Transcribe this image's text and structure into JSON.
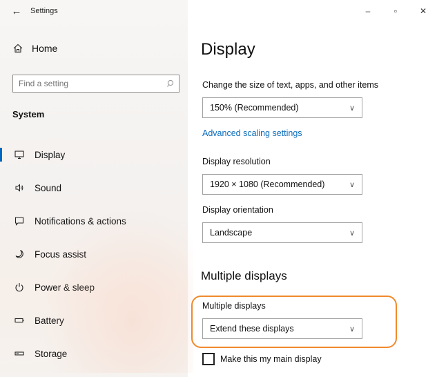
{
  "window": {
    "title": "Settings",
    "controls": {
      "minimize": "–",
      "maximize": "▫",
      "close": "✕"
    }
  },
  "sidebar": {
    "home_label": "Home",
    "search_placeholder": "Find a setting",
    "section": "System",
    "items": [
      {
        "label": "Display",
        "icon": "monitor-icon",
        "active": true
      },
      {
        "label": "Sound",
        "icon": "speaker-icon"
      },
      {
        "label": "Notifications & actions",
        "icon": "message-icon"
      },
      {
        "label": "Focus assist",
        "icon": "moon-icon"
      },
      {
        "label": "Power & sleep",
        "icon": "power-icon"
      },
      {
        "label": "Battery",
        "icon": "battery-icon"
      },
      {
        "label": "Storage",
        "icon": "storage-icon"
      }
    ]
  },
  "main": {
    "title": "Display",
    "scale": {
      "label": "Change the size of text, apps, and other items",
      "value": "150% (Recommended)"
    },
    "advanced_link": "Advanced scaling settings",
    "resolution": {
      "label": "Display resolution",
      "value": "1920 × 1080 (Recommended)"
    },
    "orientation": {
      "label": "Display orientation",
      "value": "Landscape"
    },
    "multiple_heading": "Multiple displays",
    "multiple": {
      "label": "Multiple displays",
      "value": "Extend these displays"
    },
    "main_display_checkbox": {
      "label": "Make this my main display",
      "checked": false
    }
  },
  "colors": {
    "accent": "#0067c0",
    "link": "#0a6cbd",
    "highlight": "#f08a2c"
  }
}
